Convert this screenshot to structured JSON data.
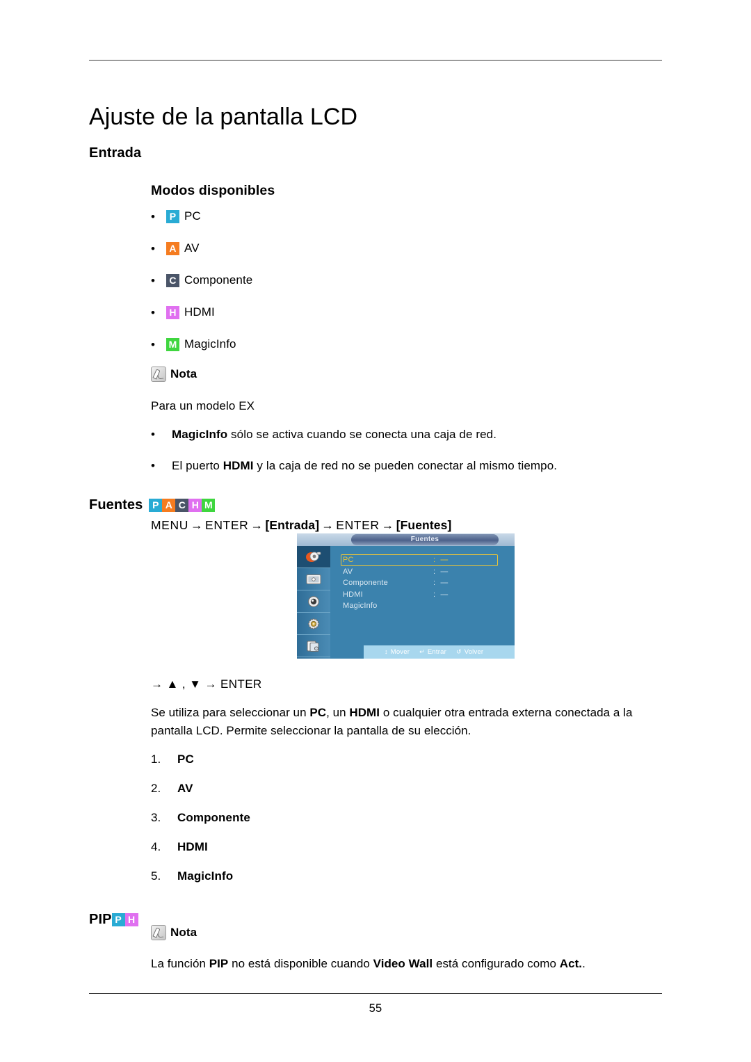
{
  "document": {
    "page_number": "55",
    "title": "Ajuste de la pantalla LCD"
  },
  "sections": {
    "entrada": {
      "heading": "Entrada",
      "subheading": "Modos disponibles",
      "modes": [
        {
          "badge": "P",
          "label": "PC",
          "color": "#29abd4"
        },
        {
          "badge": "A",
          "label": "AV",
          "color": "#f57c20"
        },
        {
          "badge": "C",
          "label": "Componente",
          "color": "#4a5568"
        },
        {
          "badge": "H",
          "label": "HDMI",
          "color": "#e070f0"
        },
        {
          "badge": "M",
          "label": "MagicInfo",
          "color": "#3fd63f"
        }
      ],
      "note": {
        "label": "Nota",
        "intro": "Para un modelo EX",
        "bullets": [
          {
            "bullet": "•",
            "pre": "",
            "bold": "MagicInfo",
            "post": " sólo se activa cuando se conecta una caja de red."
          },
          {
            "bullet": "•",
            "pre": "El puerto ",
            "bold": "HDMI",
            "post": " y la caja de red no se pueden conectar al mismo tiempo."
          }
        ]
      }
    },
    "fuentes": {
      "heading": "Fuentes",
      "badges": [
        {
          "badge": "P",
          "color": "#29abd4"
        },
        {
          "badge": "A",
          "color": "#f57c20"
        },
        {
          "badge": "C",
          "color": "#4a5568"
        },
        {
          "badge": "H",
          "color": "#e070f0"
        },
        {
          "badge": "M",
          "color": "#3fd63f"
        }
      ],
      "menu_path": {
        "step1": "MENU",
        "arrow": "→",
        "step2": "ENTER",
        "step3": "[Entrada]",
        "step4": "ENTER",
        "step5": "[Fuentes]"
      },
      "osd": {
        "title": "Fuentes",
        "rows": [
          {
            "name": "PC",
            "colon": ":",
            "value": "----",
            "selected": true
          },
          {
            "name": "AV",
            "colon": ":",
            "value": "----",
            "selected": false
          },
          {
            "name": "Componente",
            "colon": ":",
            "value": "----",
            "selected": false
          },
          {
            "name": "HDMI",
            "colon": ":",
            "value": "----",
            "selected": false
          },
          {
            "name": "MagicInfo",
            "colon": "",
            "value": "",
            "selected": false
          }
        ],
        "hints": [
          {
            "glyph": "↕",
            "label": "Mover"
          },
          {
            "glyph": "↵",
            "label": "Entrar"
          },
          {
            "glyph": "↺",
            "label": "Volver"
          }
        ],
        "highlight_color": "#e8c43a",
        "background_color": "#3b82ad"
      },
      "arrow_line": "→ ▲ , ▼ → ENTER",
      "description": {
        "p1a": "Se utiliza para seleccionar un ",
        "b1": "PC",
        "p1b": ", un ",
        "b2": "HDMI",
        "p1c": " o cualquier otra entrada externa conectada a la pantalla LCD. Permite seleccionar la pantalla de su elección."
      },
      "numbered_items": [
        {
          "index": "1.",
          "label": "PC"
        },
        {
          "index": "2.",
          "label": "AV"
        },
        {
          "index": "3.",
          "label": "Componente"
        },
        {
          "index": "4.",
          "label": "HDMI"
        },
        {
          "index": "5.",
          "label": "MagicInfo"
        }
      ]
    },
    "pip": {
      "heading": "PIP",
      "badges": [
        {
          "badge": "P",
          "color": "#29abd4"
        },
        {
          "badge": "H",
          "color": "#e070f0"
        }
      ],
      "note": {
        "label": "Nota",
        "text_a": "La función ",
        "bold_a": "PIP",
        "text_b": " no está disponible cuando ",
        "bold_b": "Video Wall",
        "text_c": " está configurado como ",
        "bold_c": "Act.",
        "text_d": "."
      }
    }
  }
}
